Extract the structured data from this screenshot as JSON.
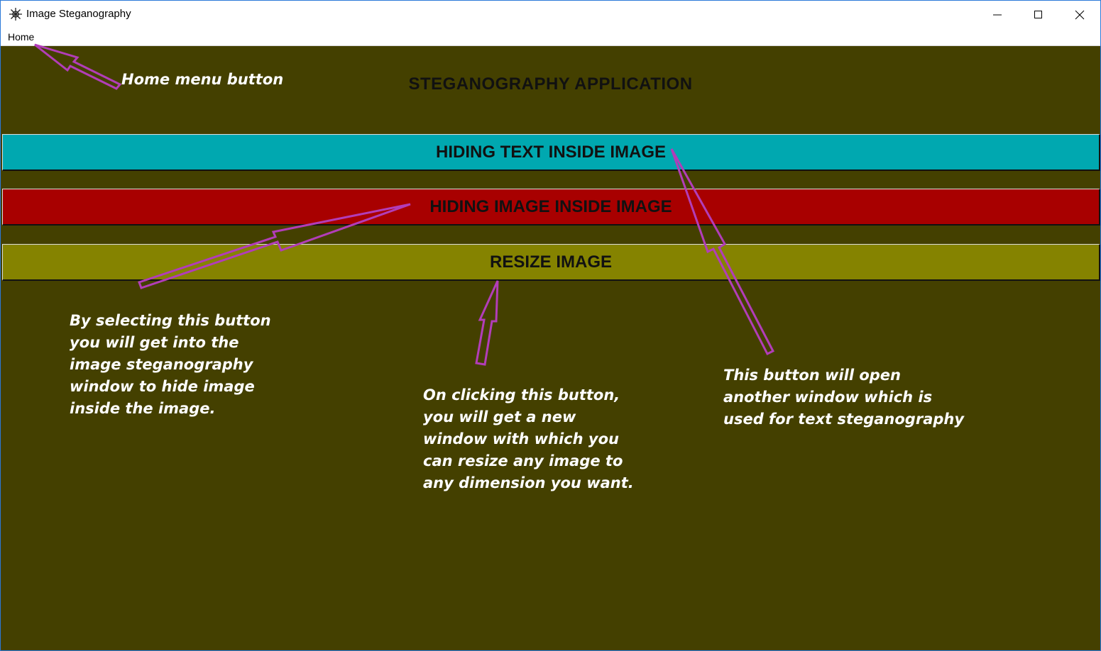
{
  "window": {
    "title": "Image Steganography",
    "icon": "app-gear-icon"
  },
  "menu": {
    "home_label": "Home"
  },
  "main": {
    "heading": "STEGANOGRAPHY APPLICATION",
    "buttons": {
      "text_label": "HIDING TEXT INSIDE IMAGE",
      "image_label": "HIDING IMAGE INSIDE IMAGE",
      "resize_label": "RESIZE IMAGE"
    }
  },
  "annotations": {
    "home": "Home menu button",
    "image": "By selecting this button\nyou will get into the\nimage steganography\nwindow to hide image\ninside the image.",
    "resize": "On clicking this button,\nyou will get a new\nwindow with which you\ncan resize any image to\nany dimension you want.",
    "text": "This button will open\nanother window which is\nused for text steganography"
  },
  "colors": {
    "background": "#444000",
    "text_button": "#00a8b0",
    "image_button": "#a80000",
    "resize_button": "#858300",
    "arrow": "#b23db8"
  }
}
